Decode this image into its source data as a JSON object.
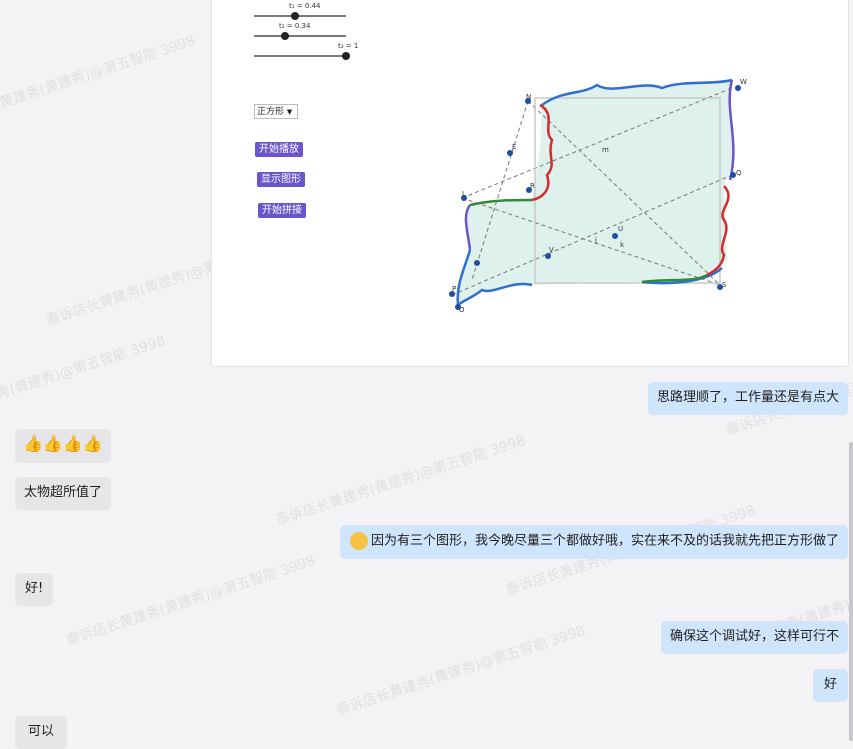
{
  "watermark": {
    "text": "泰诉店长黄建秀(黄建秀)@第五智能 3998"
  },
  "geogebra": {
    "sliders": [
      {
        "label": "t₁ = 0.44",
        "value": 0.44
      },
      {
        "label": "t₂ = 0.34",
        "value": 0.34
      },
      {
        "label": "t₃ = 1",
        "value": 1
      }
    ],
    "shape_select": "正方形",
    "buttons": {
      "play": "开始播放",
      "show": "显示图形",
      "assemble": "开始拼接"
    },
    "points": [
      "N",
      "W",
      "Q",
      "S",
      "P",
      "O",
      "L",
      "R",
      "U",
      "V",
      "E",
      "m",
      "j",
      "k"
    ]
  },
  "messages": [
    {
      "side": "me",
      "text": "思路理顺了，工作量还是有点大"
    },
    {
      "side": "other",
      "text": "👍👍👍👍"
    },
    {
      "side": "other",
      "text": "太物超所值了"
    },
    {
      "side": "me",
      "text": "因为有三个图形，我今晚尽量三个都做好哦，实在来不及的话我就先把正方形做了"
    },
    {
      "side": "other",
      "text": "好!"
    },
    {
      "side": "me",
      "text": "确保这个调试好，这样可行不"
    },
    {
      "side": "me",
      "text": "好"
    },
    {
      "side": "other",
      "text": "可以"
    }
  ]
}
